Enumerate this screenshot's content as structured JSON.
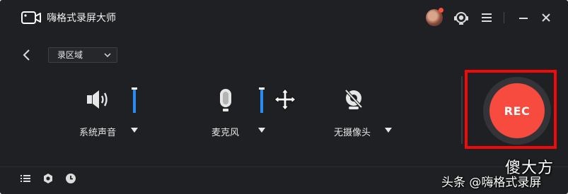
{
  "app": {
    "title": "嗨格式录屏大师"
  },
  "toolbar": {
    "avatar": "user-avatar",
    "icons": [
      "support-icon",
      "menu-icon",
      "minimize-icon",
      "close-icon"
    ]
  },
  "region_select": {
    "value": "录区域"
  },
  "devices": [
    {
      "name": "system-sound",
      "label": "系统声音",
      "icon": "speaker-icon",
      "volume": 1.0
    },
    {
      "name": "microphone",
      "label": "麦克风",
      "icon": "microphone-icon",
      "volume": 1.0
    },
    {
      "name": "camera",
      "label": "无摄像头",
      "icon": "camera-off-icon"
    }
  ],
  "rec": {
    "label": "REC"
  },
  "bottom_icons": [
    "list-icon",
    "settings-icon",
    "clock-icon"
  ],
  "watermark": {
    "big": "傻大方",
    "small": "头条 @嗨格式录屏"
  },
  "colors": {
    "background": "#1f2023",
    "accent_blue": "#2b8cf0",
    "rec_red": "#f84b3f",
    "highlight_red": "#f00a0a"
  }
}
